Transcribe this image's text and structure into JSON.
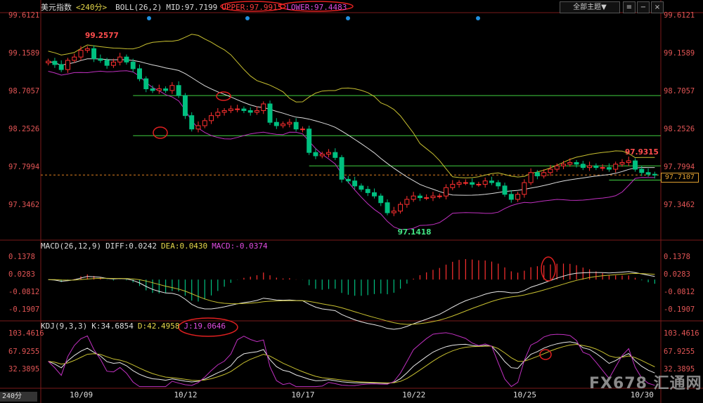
{
  "header": {
    "symbol": "美元指数",
    "period": "<240分>",
    "indicator": "BOLL(26,2)",
    "mid": "MID:97.7199",
    "upper": "UPPER:97.9915",
    "lower": "LOWER:97.4483"
  },
  "macd_header": {
    "name": "MACD(26,12,9)",
    "diff": "DIFF:0.0242",
    "dea": "DEA:0.0430",
    "macd": "MACD:-0.0374"
  },
  "kdj_header": {
    "name": "KDJ(9,3,3)",
    "k": "K:34.6854",
    "d": "D:42.4958",
    "j": "J:19.0646"
  },
  "toolbar": {
    "theme_label": "全部主题▼"
  },
  "period_tab": "240分",
  "price_tag": "97.7107",
  "watermark": "FX678 汇通网",
  "colors": {
    "up": "#ff3030",
    "down": "#00c080",
    "upper": "#c8c030",
    "mid": "#dddddd",
    "lower": "#c030c0",
    "level": "#40d040",
    "dashed": "#e08020"
  },
  "chart_data": {
    "type": "candlestick",
    "price_axis": {
      "ticks": [
        99.6121,
        99.1589,
        98.7057,
        98.2526,
        97.7994,
        97.3462
      ],
      "ylim": [
        96.95,
        99.65
      ]
    },
    "macd_axis": {
      "ticks": [
        0.1378,
        0.0283,
        -0.0812,
        -0.1907
      ],
      "ylim": [
        -0.25,
        0.19
      ]
    },
    "kdj_axis": {
      "ticks": [
        103.4616,
        67.9255,
        32.3895
      ],
      "ylim": [
        -2,
        112
      ]
    },
    "x_labels": [
      {
        "label": "10/09",
        "index": 5
      },
      {
        "label": "10/12",
        "index": 21
      },
      {
        "label": "10/17",
        "index": 39
      },
      {
        "label": "10/22",
        "index": 56
      },
      {
        "label": "10/25",
        "index": 73
      },
      {
        "label": "10/30",
        "index": 91
      }
    ],
    "annotations": {
      "high": {
        "label": "99.2577",
        "index": 5,
        "value": 99.2577
      },
      "low": {
        "label": "97.1418",
        "index": 54,
        "value": 97.1418
      },
      "recent_high": {
        "label": "97.9315",
        "index": 88,
        "value": 97.9315
      }
    },
    "levels": [
      98.66,
      98.18,
      97.82,
      97.65
    ],
    "dashed_level": 97.7107,
    "closes": [
      99.07,
      99.03,
      98.97,
      99.08,
      99.12,
      99.2,
      99.22,
      99.1,
      99.08,
      99.02,
      99.06,
      99.12,
      99.06,
      98.98,
      98.86,
      98.74,
      98.72,
      98.74,
      98.72,
      98.78,
      98.66,
      98.42,
      98.26,
      98.3,
      98.36,
      98.42,
      98.46,
      98.48,
      98.5,
      98.5,
      98.48,
      98.46,
      98.48,
      98.56,
      98.34,
      98.3,
      98.32,
      98.34,
      98.26,
      98.26,
      97.98,
      97.94,
      97.96,
      97.98,
      97.92,
      97.66,
      97.64,
      97.58,
      97.54,
      97.5,
      97.46,
      97.38,
      97.26,
      97.28,
      97.36,
      97.42,
      97.46,
      97.44,
      97.44,
      97.46,
      97.46,
      97.56,
      97.6,
      97.62,
      97.62,
      97.6,
      97.6,
      97.64,
      97.62,
      97.58,
      97.48,
      97.42,
      97.48,
      97.62,
      97.74,
      97.7,
      97.74,
      97.78,
      97.82,
      97.84,
      97.86,
      97.84,
      97.8,
      97.82,
      97.8,
      97.8,
      97.78,
      97.84,
      97.86,
      97.88,
      97.78,
      97.74,
      97.72,
      97.71
    ]
  }
}
